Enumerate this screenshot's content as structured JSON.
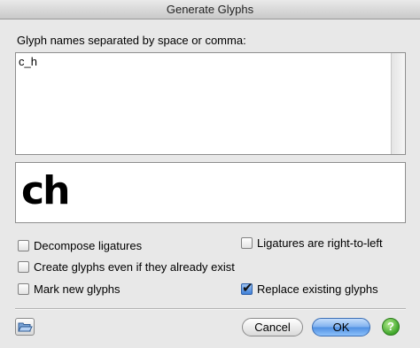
{
  "window": {
    "title": "Generate Glyphs"
  },
  "glyph_names": {
    "prompt": "Glyph names separated by space or comma:",
    "value": "c_h"
  },
  "preview": {
    "text": "ch"
  },
  "options": {
    "decompose_ligatures": {
      "label": "Decompose ligatures",
      "checked": false
    },
    "ligatures_rtl": {
      "label": "Ligatures are right-to-left",
      "checked": false
    },
    "create_even_if_exist": {
      "label": "Create glyphs even if they already exist",
      "checked": false
    },
    "mark_new": {
      "label": "Mark new glyphs",
      "checked": false
    },
    "replace_existing": {
      "label": "Replace existing glyphs",
      "checked": true
    }
  },
  "buttons": {
    "cancel": "Cancel",
    "ok": "OK",
    "help": "?"
  },
  "icons": {
    "folder": "open-folder-icon",
    "help": "help-icon",
    "checkmark": "✔"
  }
}
